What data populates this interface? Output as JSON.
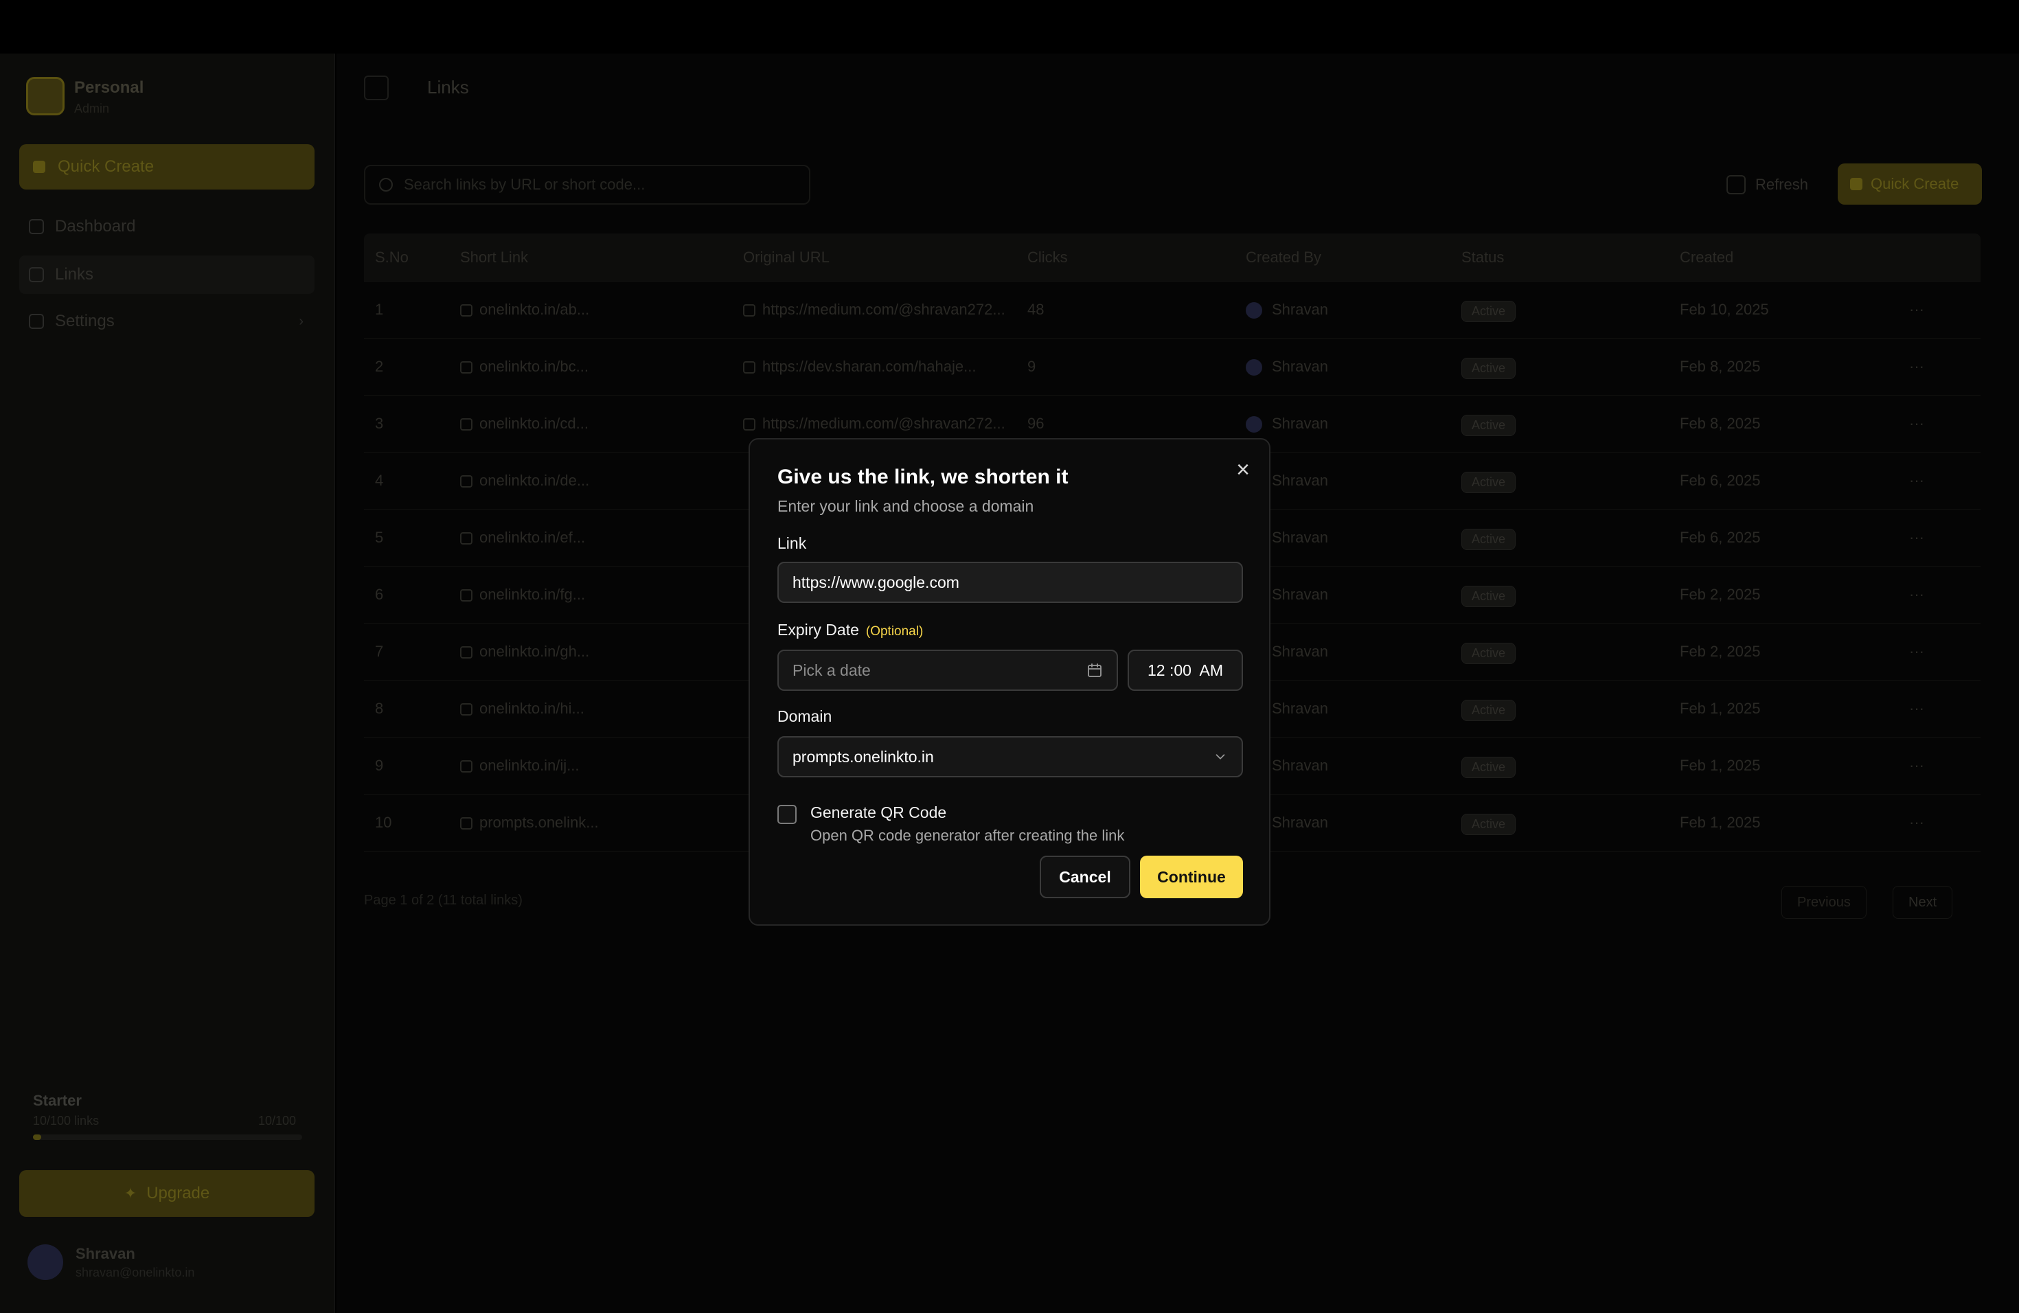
{
  "sidebar": {
    "brand_name": "Personal",
    "brand_sub": "Admin",
    "quick_create_label": "Quick Create",
    "items": [
      {
        "label": "Dashboard"
      },
      {
        "label": "Links"
      },
      {
        "label": "Settings"
      }
    ],
    "plan": {
      "title": "Starter",
      "subtitle": "10/100 links",
      "count": "10/100",
      "progress_fraction": 0.03
    },
    "upgrade_label": "Upgrade",
    "user": {
      "name": "Shravan",
      "email": "shravan@onelinkto.in"
    }
  },
  "header": {
    "title": "Links"
  },
  "toolbar": {
    "search_placeholder": "Search links by URL or short code...",
    "refresh_label": "Refresh",
    "quick_create_label": "Quick Create"
  },
  "table": {
    "columns": [
      "S.No",
      "Short Link",
      "Original URL",
      "Clicks",
      "Created By",
      "Status",
      "Created"
    ],
    "rows": [
      {
        "sno": "1",
        "short": "onelinkto.in/ab...",
        "original": "https://medium.com/@shravan272...",
        "clicks": "48",
        "by": "Shravan",
        "status": "Active",
        "created": "Feb 10, 2025"
      },
      {
        "sno": "2",
        "short": "onelinkto.in/bc...",
        "original": "https://dev.sharan.com/hahaje...",
        "clicks": "9",
        "by": "Shravan",
        "status": "Active",
        "created": "Feb 8, 2025"
      },
      {
        "sno": "3",
        "short": "onelinkto.in/cd...",
        "original": "https://medium.com/@shravan272...",
        "clicks": "96",
        "by": "Shravan",
        "status": "Active",
        "created": "Feb 8, 2025"
      },
      {
        "sno": "4",
        "short": "onelinkto.in/de...",
        "original": "",
        "clicks": "",
        "by": "Shravan",
        "status": "Active",
        "created": "Feb 6, 2025"
      },
      {
        "sno": "5",
        "short": "onelinkto.in/ef...",
        "original": "",
        "clicks": "",
        "by": "Shravan",
        "status": "Active",
        "created": "Feb 6, 2025"
      },
      {
        "sno": "6",
        "short": "onelinkto.in/fg...",
        "original": "",
        "clicks": "",
        "by": "Shravan",
        "status": "Active",
        "created": "Feb 2, 2025"
      },
      {
        "sno": "7",
        "short": "onelinkto.in/gh...",
        "original": "",
        "clicks": "",
        "by": "Shravan",
        "status": "Active",
        "created": "Feb 2, 2025"
      },
      {
        "sno": "8",
        "short": "onelinkto.in/hi...",
        "original": "",
        "clicks": "",
        "by": "Shravan",
        "status": "Active",
        "created": "Feb 1, 2025"
      },
      {
        "sno": "9",
        "short": "onelinkto.in/ij...",
        "original": "",
        "clicks": "",
        "by": "Shravan",
        "status": "Active",
        "created": "Feb 1, 2025"
      },
      {
        "sno": "10",
        "short": "prompts.onelink...",
        "original": "",
        "clicks": "",
        "by": "Shravan",
        "status": "Active",
        "created": "Feb 1, 2025"
      }
    ],
    "pager_text": "Page 1 of 2 (11 total links)",
    "prev_label": "Previous",
    "next_label": "Next"
  },
  "modal": {
    "title": "Give us the link, we shorten it",
    "subtitle": "Enter your link and choose a domain",
    "link_label": "Link",
    "link_value": "https://www.google.com",
    "expiry_label": "Expiry Date",
    "expiry_optional": "(Optional)",
    "date_placeholder": "Pick a date",
    "time_value": "12 :00  AM",
    "domain_label": "Domain",
    "domain_value": "prompts.onelinkto.in",
    "qr_label": "Generate QR Code",
    "qr_desc": "Open QR code generator after creating the link",
    "qr_checked": false,
    "cancel_label": "Cancel",
    "continue_label": "Continue",
    "accent_color": "#fbdc4d"
  }
}
